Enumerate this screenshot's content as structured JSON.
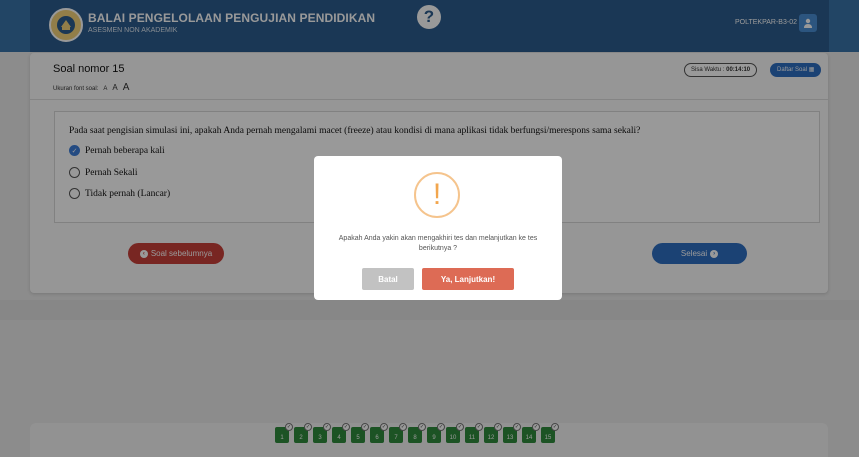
{
  "header": {
    "title": "BALAI PENGELOLAAN PENGUJIAN PENDIDIKAN",
    "subtitle": "ASESMEN NON AKADEMIK",
    "user": "POLTEKPAR-B3-02"
  },
  "question": {
    "title": "Soal nomor 15",
    "font_size_label": "Ukuran font soal:",
    "font_sizes": [
      "A",
      "A",
      "A"
    ],
    "timer_label": "Sisa Waktu : ",
    "timer_value": "00:14:10",
    "list_button": "Daftar Soal",
    "text": "Pada saat pengisian simulasi ini, apakah Anda pernah mengalami macet (freeze) atau kondisi di mana aplikasi tidak berfungsi/merespons sama sekali?",
    "options": [
      {
        "label": "Pernah beberapa kali",
        "selected": true
      },
      {
        "label": "Pernah Sekali",
        "selected": false
      },
      {
        "label": "Tidak pernah (Lancar)",
        "selected": false
      }
    ],
    "prev_button": "Soal sebelumnya",
    "next_button": "Selesai"
  },
  "navigator": {
    "numbers": [
      "1",
      "2",
      "3",
      "4",
      "5",
      "6",
      "7",
      "8",
      "9",
      "10",
      "11",
      "12",
      "13",
      "14",
      "15"
    ],
    "color": "#2f8a3c"
  },
  "modal": {
    "message": "Apakah Anda yakin akan mengakhiri tes dan melanjutkan ke tes berikutnya ?",
    "cancel": "Batal",
    "confirm": "Ya, Lanjutkan!",
    "icon": "warning-icon",
    "confirm_color": "#dd6b55"
  }
}
